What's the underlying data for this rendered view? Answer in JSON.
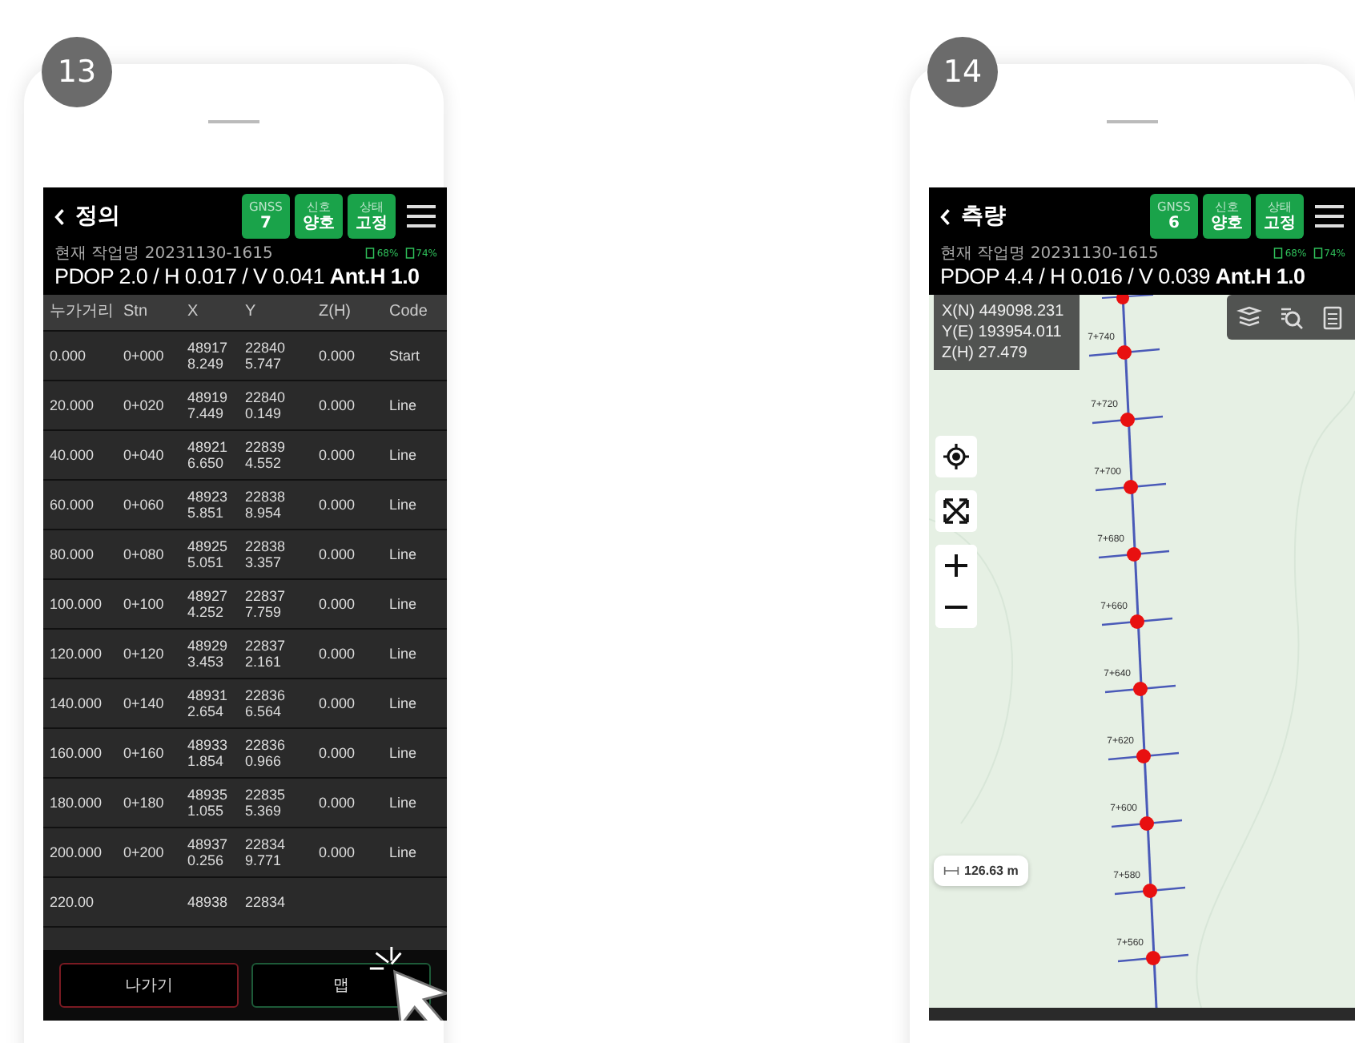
{
  "steps": [
    {
      "number": "13",
      "kind": "table",
      "header": {
        "title": "정의",
        "badges": [
          {
            "label": "GNSS",
            "value": "7"
          },
          {
            "label": "신호",
            "value": "양호"
          },
          {
            "label": "상태",
            "value": "고정"
          }
        ],
        "job": "현재 작업명 20231130-1615",
        "battery": "68%",
        "storage": "74%",
        "dop": "PDOP 2.0 / H 0.017 / V 0.041 **Ant.H 1.0**"
      },
      "table": {
        "columns": [
          "누가거리",
          "Stn",
          "X",
          "Y",
          "Z(H)",
          "Code"
        ],
        "rows": [
          [
            "0.000",
            "0+000",
            "489178.249",
            "228405.747",
            "0.000",
            "Start"
          ],
          [
            "20.000",
            "0+020",
            "489197.449",
            "228400.149",
            "0.000",
            "Line"
          ],
          [
            "40.000",
            "0+040",
            "489216.650",
            "228394.552",
            "0.000",
            "Line"
          ],
          [
            "60.000",
            "0+060",
            "489235.851",
            "228388.954",
            "0.000",
            "Line"
          ],
          [
            "80.000",
            "0+080",
            "489255.051",
            "228383.357",
            "0.000",
            "Line"
          ],
          [
            "100.000",
            "0+100",
            "489274.252",
            "228377.759",
            "0.000",
            "Line"
          ],
          [
            "120.000",
            "0+120",
            "489293.453",
            "228372.161",
            "0.000",
            "Line"
          ],
          [
            "140.000",
            "0+140",
            "489312.654",
            "228366.564",
            "0.000",
            "Line"
          ],
          [
            "160.000",
            "0+160",
            "489331.854",
            "228360.966",
            "0.000",
            "Line"
          ],
          [
            "180.000",
            "0+180",
            "489351.055",
            "228355.369",
            "0.000",
            "Line"
          ],
          [
            "200.000",
            "0+200",
            "489370.256",
            "228349.771",
            "0.000",
            "Line"
          ],
          [
            "220.00",
            "",
            "48938",
            "22834",
            "",
            ""
          ]
        ]
      },
      "buttons": [
        {
          "label": "나가기",
          "kind": "exit"
        },
        {
          "label": "맵",
          "kind": "map"
        }
      ]
    },
    {
      "number": "14",
      "kind": "map",
      "header": {
        "title": "측량",
        "badges": [
          {
            "label": "GNSS",
            "value": "6"
          },
          {
            "label": "신호",
            "value": "양호"
          },
          {
            "label": "상태",
            "value": "고정"
          }
        ],
        "job": "현재 작업명 20231130-1615",
        "battery": "68%",
        "storage": "74%",
        "dop": "PDOP 4.4 / H 0.016 / V 0.039 **Ant.H 1.0**"
      },
      "map": {
        "coordinates": [
          "X(N) 449098.231",
          "Y(E) 193954.011",
          "Z(H) 27.479"
        ],
        "stations": [
          "7+740",
          "7+720",
          "7+700",
          "7+680",
          "7+660",
          "7+640",
          "7+620",
          "7+600",
          "7+580",
          "7+560"
        ],
        "scale": "126.63 m"
      }
    }
  ]
}
